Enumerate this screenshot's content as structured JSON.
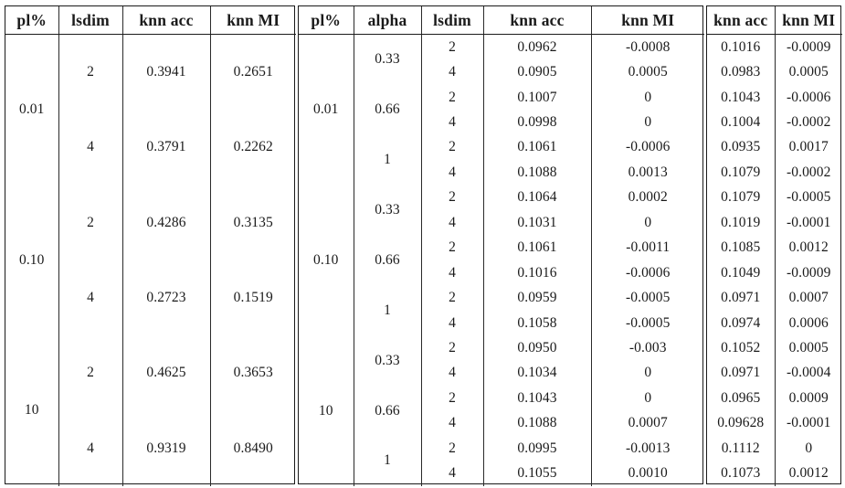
{
  "figure": {
    "kind": "results-table",
    "blocks": 3
  },
  "left_table": {
    "headers": [
      "pl%",
      "lsdim",
      "knn acc",
      "knn MI"
    ],
    "groups": [
      {
        "plpct": "0.01",
        "rows": [
          {
            "lsdim": "2",
            "knn_acc": "0.3941",
            "knn_mi": "0.2651"
          },
          {
            "lsdim": "4",
            "knn_acc": "0.3791",
            "knn_mi": "0.2262"
          }
        ]
      },
      {
        "plpct": "0.10",
        "rows": [
          {
            "lsdim": "2",
            "knn_acc": "0.4286",
            "knn_mi": "0.3135"
          },
          {
            "lsdim": "4",
            "knn_acc": "0.2723",
            "knn_mi": "0.1519"
          }
        ]
      },
      {
        "plpct": "10",
        "rows": [
          {
            "lsdim": "2",
            "knn_acc": "0.4625",
            "knn_mi": "0.3653"
          },
          {
            "lsdim": "4",
            "knn_acc": "0.9319",
            "knn_mi": "0.8490"
          }
        ]
      }
    ]
  },
  "mid_table": {
    "headers": [
      "pl%",
      "alpha",
      "lsdim",
      "knn acc",
      "knn MI"
    ],
    "groups": [
      {
        "plpct": "0.01",
        "alphas": [
          {
            "alpha": "0.33",
            "rows": [
              {
                "lsdim": "2",
                "knn_acc": "0.0962",
                "knn_mi": "-0.0008"
              },
              {
                "lsdim": "4",
                "knn_acc": "0.0905",
                "knn_mi": "0.0005"
              }
            ]
          },
          {
            "alpha": "0.66",
            "rows": [
              {
                "lsdim": "2",
                "knn_acc": "0.1007",
                "knn_mi": "0"
              },
              {
                "lsdim": "4",
                "knn_acc": "0.0998",
                "knn_mi": "0"
              }
            ]
          },
          {
            "alpha": "1",
            "rows": [
              {
                "lsdim": "2",
                "knn_acc": "0.1061",
                "knn_mi": "-0.0006"
              },
              {
                "lsdim": "4",
                "knn_acc": "0.1088",
                "knn_mi": "0.0013"
              }
            ]
          }
        ]
      },
      {
        "plpct": "0.10",
        "alphas": [
          {
            "alpha": "0.33",
            "rows": [
              {
                "lsdim": "2",
                "knn_acc": "0.1064",
                "knn_mi": "0.0002"
              },
              {
                "lsdim": "4",
                "knn_acc": "0.1031",
                "knn_mi": "0"
              }
            ]
          },
          {
            "alpha": "0.66",
            "rows": [
              {
                "lsdim": "2",
                "knn_acc": "0.1061",
                "knn_mi": "-0.0011"
              },
              {
                "lsdim": "4",
                "knn_acc": "0.1016",
                "knn_mi": "-0.0006"
              }
            ]
          },
          {
            "alpha": "1",
            "rows": [
              {
                "lsdim": "2",
                "knn_acc": "0.0959",
                "knn_mi": "-0.0005"
              },
              {
                "lsdim": "4",
                "knn_acc": "0.1058",
                "knn_mi": "-0.0005"
              }
            ]
          }
        ]
      },
      {
        "plpct": "10",
        "alphas": [
          {
            "alpha": "0.33",
            "rows": [
              {
                "lsdim": "2",
                "knn_acc": "0.0950",
                "knn_mi": "-0.003"
              },
              {
                "lsdim": "4",
                "knn_acc": "0.1034",
                "knn_mi": "0"
              }
            ]
          },
          {
            "alpha": "0.66",
            "rows": [
              {
                "lsdim": "2",
                "knn_acc": "0.1043",
                "knn_mi": "0"
              },
              {
                "lsdim": "4",
                "knn_acc": "0.1088",
                "knn_mi": "0.0007"
              }
            ]
          },
          {
            "alpha": "1",
            "rows": [
              {
                "lsdim": "2",
                "knn_acc": "0.0995",
                "knn_mi": "-0.0013"
              },
              {
                "lsdim": "4",
                "knn_acc": "0.1055",
                "knn_mi": "0.0010"
              }
            ]
          }
        ]
      }
    ]
  },
  "right_table": {
    "headers": [
      "knn acc",
      "knn MI"
    ],
    "rows": [
      {
        "knn_acc": "0.1016",
        "knn_mi": "-0.0009"
      },
      {
        "knn_acc": "0.0983",
        "knn_mi": "0.0005"
      },
      {
        "knn_acc": "0.1043",
        "knn_mi": "-0.0006"
      },
      {
        "knn_acc": "0.1004",
        "knn_mi": "-0.0002"
      },
      {
        "knn_acc": "0.0935",
        "knn_mi": "0.0017"
      },
      {
        "knn_acc": "0.1079",
        "knn_mi": "-0.0002"
      },
      {
        "knn_acc": "0.1079",
        "knn_mi": "-0.0005"
      },
      {
        "knn_acc": "0.1019",
        "knn_mi": "-0.0001"
      },
      {
        "knn_acc": "0.1085",
        "knn_mi": "0.0012"
      },
      {
        "knn_acc": "0.1049",
        "knn_mi": "-0.0009"
      },
      {
        "knn_acc": "0.0971",
        "knn_mi": "0.0007"
      },
      {
        "knn_acc": "0.0974",
        "knn_mi": "0.0006"
      },
      {
        "knn_acc": "0.1052",
        "knn_mi": "0.0005"
      },
      {
        "knn_acc": "0.0971",
        "knn_mi": "-0.0004"
      },
      {
        "knn_acc": "0.0965",
        "knn_mi": "0.0009"
      },
      {
        "knn_acc": "0.09628",
        "knn_mi": "-0.0001"
      },
      {
        "knn_acc": "0.1112",
        "knn_mi": "0"
      },
      {
        "knn_acc": "0.1073",
        "knn_mi": "0.0012"
      }
    ]
  }
}
